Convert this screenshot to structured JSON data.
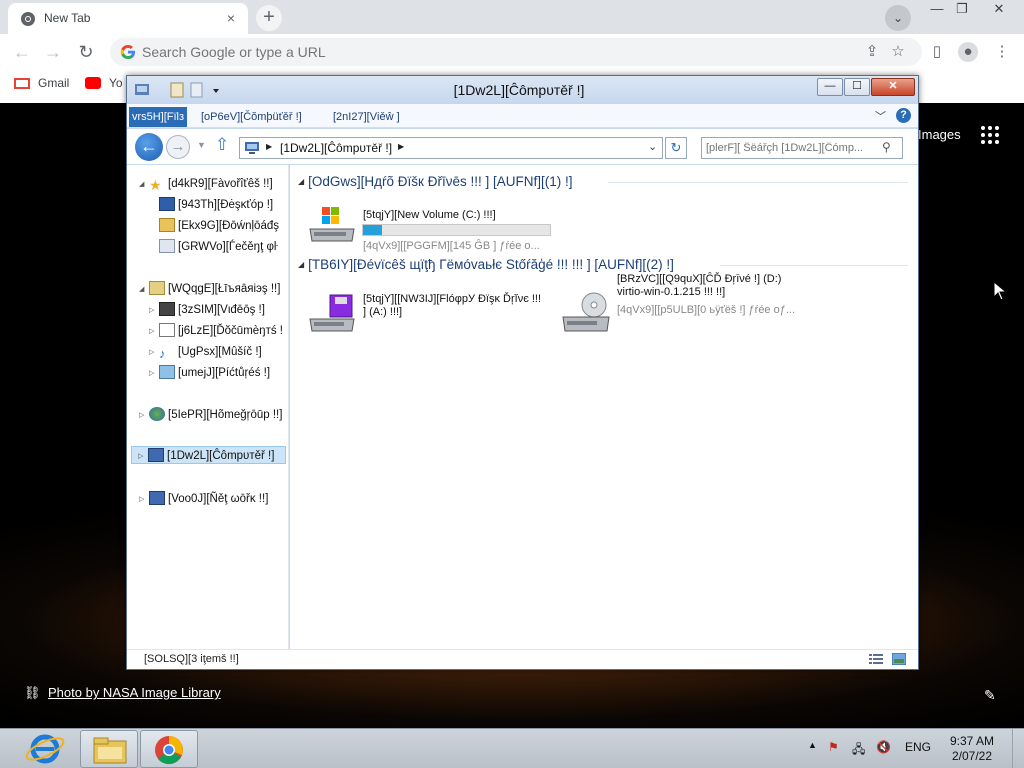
{
  "browser": {
    "tab_title": "New Tab",
    "tab_close": "×",
    "new_tab": "+",
    "tab_search": "⌄",
    "omnibox_placeholder": "Search Google or type a URL",
    "window_controls": [
      "—",
      "❐",
      "✕"
    ],
    "bookmarks": [
      {
        "label": "Gmail",
        "icon": "gmail-icon"
      },
      {
        "label": "Yo",
        "icon": "youtube-icon"
      }
    ]
  },
  "ntp": {
    "images_link": "Images",
    "photo_credit": "Photo by NASA Image Library"
  },
  "explorer": {
    "title": "[1Dw2L][Ĉômрυтěř !]",
    "ribbon_tabs": [
      "vrs5H][Fïlз",
      "[oP6eV][Čŏmþüťěř !]",
      "[2nI27][Vіěŵ ]"
    ],
    "address_crumb": "[1Dw2L][Ĉômрυтěř !]",
    "search_placeholder": "[plerF][ Ŝëářçĥ [1Dw2L][Ĉómр...",
    "nav_items": [
      {
        "label": "[d4kR9][Fàvořîťêš !!]",
        "icon": "star-icon",
        "level": 0,
        "expanded": true
      },
      {
        "label": "[943Th][Ðėşĸťóр !]",
        "icon": "desktop-icon",
        "level": 1
      },
      {
        "label": "[Ekx9G][Ðōẃnļōáđş",
        "icon": "downloads-icon",
        "level": 1
      },
      {
        "label": "[GRWVo][Ѓеčěŋţ φŀ",
        "icon": "recent-places-icon",
        "level": 1
      },
      {
        "label": "[WQqgE][Łīъяāяіэş !!]",
        "icon": "libraries-icon",
        "level": 0,
        "expanded": true
      },
      {
        "label": "[3zSIM][Vιđēōş !]",
        "icon": "videos-icon",
        "level": 1
      },
      {
        "label": "[j6LzE][Ďŏčūmèŋтś !",
        "icon": "documents-icon",
        "level": 1
      },
      {
        "label": "[UgPsx][Мûšíč !]",
        "icon": "music-icon",
        "level": 1
      },
      {
        "label": "[umejJ][Píćtůŗéś !]",
        "icon": "pictures-icon",
        "level": 1
      },
      {
        "label": "[5IePR][Hõmеğŗōūр !!]",
        "icon": "homegroup-icon",
        "level": 0
      },
      {
        "label": "[1Dw2L][Ĉômрυтěř !]",
        "icon": "computer-icon",
        "level": 0,
        "selected": true
      },
      {
        "label": "[Voo0J][Ñěţ ωōřĸ !!]",
        "icon": "network-icon",
        "level": 0
      }
    ],
    "groups": [
      {
        "header": "[OdGws][Hдŕõ Ðïšк Ðřīνēs !!! ] [AUFNf][(1) !]"
      },
      {
        "header": "[TB6IY][Ðévïcêš щïţђ Гёмóvаьłє Stőŕăģé !!! !!! ] [AUFNf][(2) !]"
      }
    ],
    "drives": [
      {
        "name": "[5tqjY][New Volume (C:) !!!]",
        "sub": "[4qVx9][[PGGFM][145 ĜB ] ƒŕéе о...",
        "used_fraction": 0.1,
        "icon": "hard-drive-icon"
      },
      {
        "name": "[5tqjY][[NW3IJ][FlóφрУ Ðïşĸ Ďŗĭνє !!! ] (A:) !!!]",
        "sub": "",
        "icon": "floppy-drive-icon"
      },
      {
        "name": "[BRzVC][[Q9quX][ĈĎ Ðŗīνé !] (D:) virtio-win-0.1.215 !!! !!]",
        "sub": "[4qVx9][[p5ULB][0 ьÿťёš !] ƒŕéе оƒ...",
        "icon": "cd-drive-icon"
      }
    ],
    "status": "[SOLSQ][3 іţеmš !!]",
    "window_controls": [
      "—",
      "☐",
      "✕"
    ]
  },
  "taskbar": {
    "apps": [
      "internet-explorer-icon",
      "file-explorer-icon",
      "chrome-icon"
    ],
    "lang": "ENG",
    "time": "9:37 AM",
    "date": "2/07/22"
  }
}
